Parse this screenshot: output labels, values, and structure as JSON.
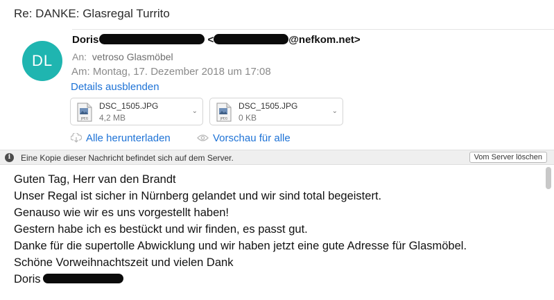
{
  "subject": "Re: DANKE: Glasregal Turrito",
  "sender": {
    "avatar_initials": "DL",
    "avatar_color": "#1fb5b0",
    "first_name": "Doris",
    "email_domain": "@nefkom.net>",
    "email_open": "<"
  },
  "recipient": {
    "label": "An:",
    "value": "vetroso Glasmöbel"
  },
  "date": "Am: Montag, 17. Dezember 2018 um 17:08",
  "details_link": "Details ausblenden",
  "attachments": [
    {
      "name": "DSC_1505.JPG",
      "size": "4,2 MB",
      "type_label": "JPEG"
    },
    {
      "name": "DSC_1505.JPG",
      "size": "0 KB",
      "type_label": "JPEG"
    }
  ],
  "actions": {
    "download_all": "Alle herunterladen",
    "preview_all": "Vorschau für alle"
  },
  "server_notice": {
    "text": "Eine Kopie dieser Nachricht befindet sich auf dem Server.",
    "button": "Vom Server löschen"
  },
  "message": {
    "lines": [
      "Guten Tag, Herr van den Brandt",
      "Unser Regal ist sicher in Nürnberg gelandet und wir sind total begeistert.",
      "Genauso wie wir es uns vorgestellt haben!",
      "Gestern habe ich es bestückt und wir finden, es passt gut.",
      "Danke für die supertolle Abwicklung und wir haben jetzt eine gute Adresse für Glasmöbel.",
      "Schöne Vorweihnachtszeit und vielen Dank"
    ],
    "signature": "Doris"
  },
  "colors": {
    "link": "#1d72d6",
    "redaction": "#0b0b0b"
  }
}
